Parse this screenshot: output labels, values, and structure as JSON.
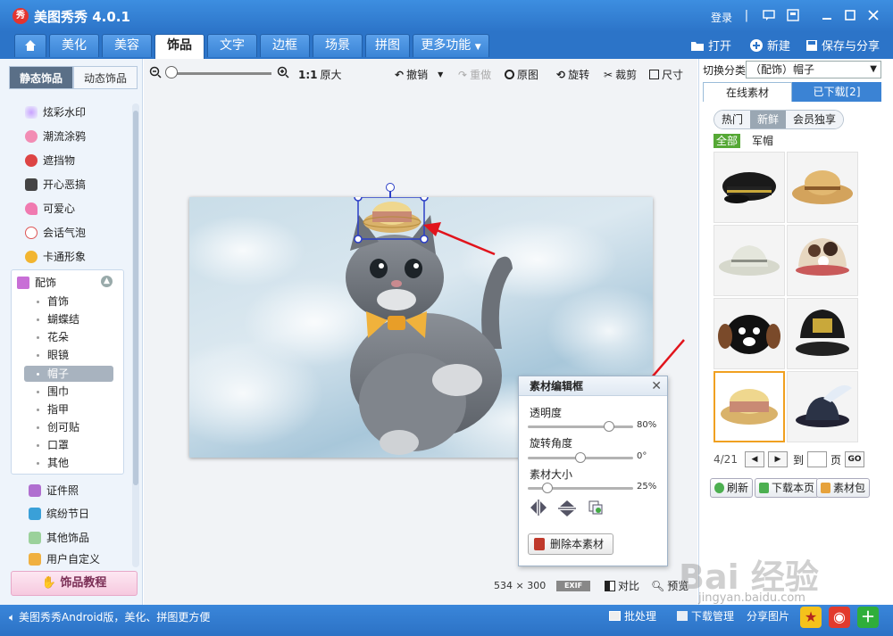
{
  "window": {
    "logo_char": "秀",
    "title": "美图秀秀 4.0.1",
    "login": "登录"
  },
  "tabs": [
    {
      "label": "美化"
    },
    {
      "label": "美容"
    },
    {
      "label": "饰品"
    },
    {
      "label": "文字"
    },
    {
      "label": "边框"
    },
    {
      "label": "场景"
    },
    {
      "label": "拼图"
    },
    {
      "label": "更多功能"
    }
  ],
  "top_actions": {
    "open": "打开",
    "new": "新建",
    "save_share": "保存与分享"
  },
  "sidebar": {
    "tabs": {
      "static": "静态饰品",
      "dynamic": "动态饰品"
    },
    "items": [
      {
        "label": "炫彩水印",
        "icon": "sparkle-icon"
      },
      {
        "label": "潮流涂鸦",
        "icon": "lips-icon"
      },
      {
        "label": "遮挡物",
        "icon": "mask-icon"
      },
      {
        "label": "开心恶搞",
        "icon": "funny-icon"
      },
      {
        "label": "可爱心",
        "icon": "heart-icon"
      },
      {
        "label": "会话气泡",
        "icon": "bubble-icon"
      },
      {
        "label": "卡通形象",
        "icon": "cartoon-icon"
      }
    ],
    "group_header": "配饰",
    "sub_items": [
      "首饰",
      "蝴蝶结",
      "花朵",
      "眼镜",
      "帽子",
      "围巾",
      "指甲",
      "创可贴",
      "口罩",
      "其他"
    ],
    "selected_sub": "帽子",
    "items_after": [
      {
        "label": "证件照",
        "icon": "shirt-icon"
      },
      {
        "label": "缤纷节日",
        "icon": "gift-icon"
      },
      {
        "label": "其他饰品",
        "icon": "star-icon"
      },
      {
        "label": "用户自定义",
        "icon": "folder-icon"
      }
    ],
    "tutorial": "饰品教程"
  },
  "toolbar": {
    "ratio": "1:1",
    "original_size": "原大",
    "undo": "撤销",
    "redo": "重做",
    "original": "原图",
    "rotate": "旋转",
    "crop": "裁剪",
    "size": "尺寸"
  },
  "canvas": {
    "width": "534",
    "x": "×",
    "height": "300",
    "exif": "EXIF",
    "compare": "对比",
    "preview": "预览"
  },
  "material_panel": {
    "title": "素材编辑框",
    "opacity_label": "透明度",
    "opacity_value": "80%",
    "opacity": 0.8,
    "rotation_label": "旋转角度",
    "rotation_value": "0°",
    "rotation": 0.5,
    "size_label": "素材大小",
    "size_value": "25%",
    "size": 0.15,
    "delete": "删除本素材"
  },
  "right_panel": {
    "switch_label": "切换分类",
    "category": "（配饰）帽子",
    "tab_online": "在线素材",
    "tab_downloaded": "已下载[2]",
    "pills": [
      "热门",
      "新鲜",
      "会员独享"
    ],
    "active_pill": "新鲜",
    "filters": [
      "全部",
      "军帽"
    ],
    "page_current": "4/21",
    "goto_label": "到",
    "page_label": "页",
    "go": "GO",
    "refresh": "刷新",
    "download_page": "下载本页",
    "material_pack": "素材包"
  },
  "statusbar": {
    "promo": "美图秀秀Android版，美化、拼图更方便",
    "batch": "批处理",
    "download_manager": "下载管理",
    "share_image": "分享图片"
  },
  "watermark": {
    "main": "Bai 经验",
    "sub": "jingyan.baidu.com"
  }
}
